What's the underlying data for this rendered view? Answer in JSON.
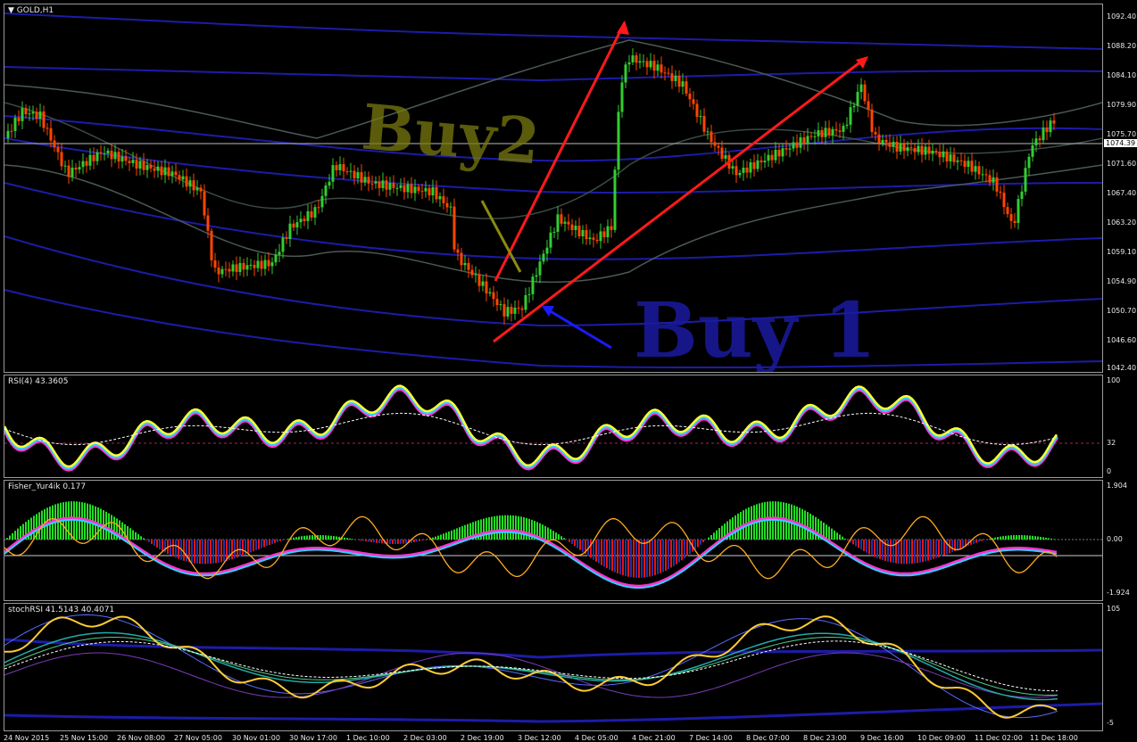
{
  "main_chart": {
    "title": "GOLD,H1",
    "current_price": "1074.39",
    "annotations": {
      "buy2": "Buy2",
      "buy1": "Buy 1"
    },
    "price_scale": [
      "1092.40",
      "1088.20",
      "1084.10",
      "1079.90",
      "1075.70",
      "1071.60",
      "1067.40",
      "1063.20",
      "1059.10",
      "1054.90",
      "1050.70",
      "1046.60",
      "1042.40"
    ]
  },
  "rsi_panel": {
    "label": "RSI(4) 43.3605",
    "scale": [
      "100",
      "32",
      "0"
    ]
  },
  "fisher_panel": {
    "label": "Fisher_Yur4ik 0.177",
    "scale": [
      "1.904",
      "0.00",
      "-1.924"
    ]
  },
  "stochrsi_panel": {
    "label": "stochRSI 41.5143 40.4071",
    "scale": [
      "105",
      "-5"
    ]
  },
  "time_axis": [
    "24 Nov 2015",
    "25 Nov 15:00",
    "26 Nov 08:00",
    "27 Nov 05:00",
    "30 Nov 01:00",
    "30 Nov 17:00",
    "1 Dec 10:00",
    "2 Dec 03:00",
    "2 Dec 19:00",
    "3 Dec 12:00",
    "4 Dec 05:00",
    "4 Dec 21:00",
    "7 Dec 14:00",
    "8 Dec 07:00",
    "8 Dec 23:00",
    "9 Dec 16:00",
    "10 Dec 09:00",
    "11 Dec 02:00",
    "11 Dec 18:00"
  ],
  "colors": {
    "background": "#000000",
    "bull_candle": "#32cd32",
    "bear_candle": "#ff4500",
    "arrow_red": "#ff1a1a",
    "arrow_blue": "#1a1aff",
    "rsi_yellow": "#ffff33",
    "fisher_green": "#22dd22",
    "fisher_red": "#ee1111",
    "stoch_yellow": "#ffcc33"
  }
}
